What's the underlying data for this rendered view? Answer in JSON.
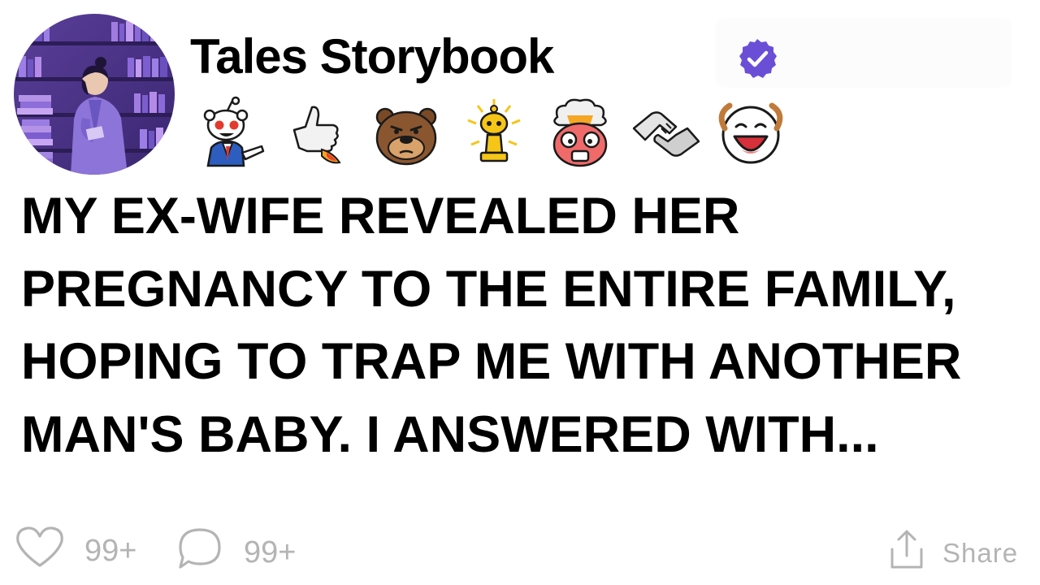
{
  "post": {
    "channel_name": "Tales Storybook",
    "verified": true,
    "title": "MY EX-WIFE REVEALED HER PREGNANCY TO THE ENTIRE FAMILY, HOPING TO TRAP ME WITH ANOTHER MAN'S BABY. I ANSWERED WITH..."
  },
  "awards": [
    {
      "icon": "pointing-snoo-award-icon"
    },
    {
      "icon": "rocket-thumbs-up-award-icon"
    },
    {
      "icon": "bear-face-award-icon"
    },
    {
      "icon": "gold-trophy-snoo-award-icon"
    },
    {
      "icon": "mind-blown-award-icon"
    },
    {
      "icon": "handshake-award-icon"
    },
    {
      "icon": "laughing-snoo-award-icon"
    }
  ],
  "footer": {
    "likes_count": "99+",
    "comments_count": "99+",
    "share_label": "Share"
  },
  "colors": {
    "verified_badge": "#6a4fd6",
    "footer_text": "#b4b4b4",
    "title_text": "#000000"
  }
}
